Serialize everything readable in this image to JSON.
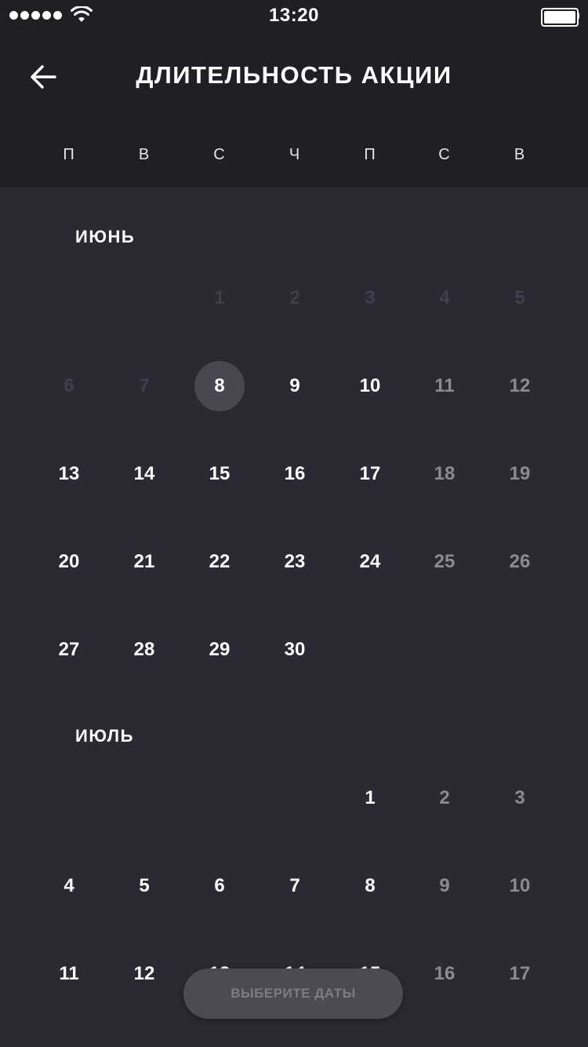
{
  "status_bar": {
    "time": "13:20",
    "signal_icon": "signal-dots-icon",
    "wifi_icon": "wifi-icon",
    "battery_icon": "battery-icon"
  },
  "header": {
    "title": "ДЛИТЕЛЬНОСТЬ АКЦИИ",
    "back_icon": "arrow-left-icon"
  },
  "weekdays": [
    "П",
    "В",
    "С",
    "Ч",
    "П",
    "С",
    "В"
  ],
  "colors": {
    "header_bg": "#1f2026",
    "calendar_bg": "#292a34",
    "selected_circle": "#474852",
    "disabled_text": "#3e404b",
    "weekend_text": "#8a8b94"
  },
  "months": [
    {
      "name": "ИЮНЬ",
      "first_weekday_index": 2,
      "days_in_month": 30,
      "disabled_days": [
        1,
        2,
        3,
        4,
        5,
        6,
        7
      ],
      "selected_day": 8
    },
    {
      "name": "ИЮЛЬ",
      "first_weekday_index": 4,
      "days_in_month": 17,
      "disabled_days": [],
      "selected_day": null
    }
  ],
  "footer": {
    "button_label": "ВЫБЕРИТЕ ДАТЫ"
  }
}
